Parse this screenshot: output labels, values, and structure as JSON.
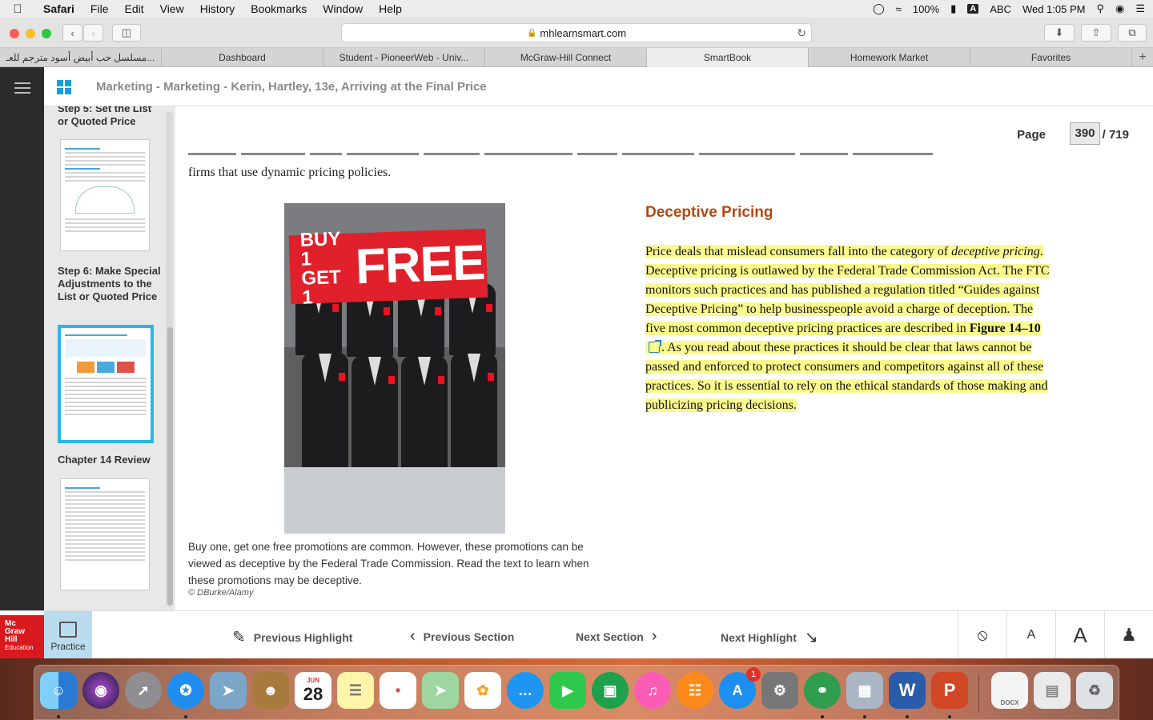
{
  "menubar": {
    "app": "Safari",
    "items": [
      "File",
      "Edit",
      "View",
      "History",
      "Bookmarks",
      "Window",
      "Help"
    ],
    "battery": "100%",
    "input_letter": "A",
    "input_source": "ABC",
    "clock": "Wed 1:05 PM"
  },
  "browser": {
    "url": "mhlearnsmart.com",
    "tabs": [
      {
        "label": "مسلسل حب أبيض أسود مترجم للعـ..."
      },
      {
        "label": "Dashboard"
      },
      {
        "label": "Student - PioneerWeb - Univ..."
      },
      {
        "label": "McGraw-Hill Connect"
      },
      {
        "label": "SmartBook"
      },
      {
        "label": "Homework Market"
      },
      {
        "label": "Favorites"
      }
    ],
    "active_tab": 4,
    "new_tab_symbol": "+"
  },
  "header": {
    "breadcrumb": "Marketing - Marketing - Kerin, Hartley, 13e, Arriving at the Final Price"
  },
  "sidebar": {
    "sections": [
      {
        "title": "Step 5: Set the List or Quoted Price"
      },
      {
        "title": "Step 6: Make Special Adjustments to the List or Quoted Price"
      },
      {
        "title": "Chapter 14 Review"
      }
    ]
  },
  "reader": {
    "page_label": "Page",
    "page_current": "390",
    "page_total": "/ 719",
    "first_line": "firms that use dynamic pricing policies.",
    "photo_sign_small": "BUY 1 GET 1",
    "photo_sign_big": "FREE",
    "caption": "Buy one, get one free promotions are common. However, these promotions can be viewed as deceptive by the Federal Trade Commission. Read the text to learn when these promotions may be deceptive.",
    "credit": "© DBurke/Alamy",
    "heading": "Deceptive Pricing",
    "para_part1": "Price deals that mislead consumers fall into the category of ",
    "para_italic": "deceptive pricing",
    "para_part2": ". Deceptive pricing is outlawed by the Federal Trade Commission Act. The FTC monitors such practices and has published a regulation titled “Guides against Deceptive Pricing” to help businesspeople avoid a charge of deception. The five most common deceptive pricing practices are described in ",
    "figure_ref": "Figure 14–10",
    "para_part3": ". As you read about these practices it should be clear that laws cannot be passed and enforced to protect consumers and competitors against all of these practices. So it is essential to rely on the ethical standards of those making and publicizing pricing decisions."
  },
  "bottombar": {
    "logo_lines": [
      "Mc",
      "Graw",
      "Hill",
      "Education"
    ],
    "practice": "Practice",
    "prev_highlight": "Previous Highlight",
    "prev_section": "Previous Section",
    "next_section": "Next Section",
    "next_highlight": "Next Highlight",
    "font_small": "A",
    "font_large": "A"
  },
  "dock": {
    "calendar_month": "JUN",
    "calendar_day": "28",
    "appstore_badge": "1",
    "word_letter": "W",
    "ppt_letter": "P",
    "docx_label": "DOCX"
  },
  "colors": {
    "highlight": "#fafa8e",
    "heading": "#b14a12",
    "accent": "#2ab7ea",
    "brand_red": "#d8191e"
  }
}
